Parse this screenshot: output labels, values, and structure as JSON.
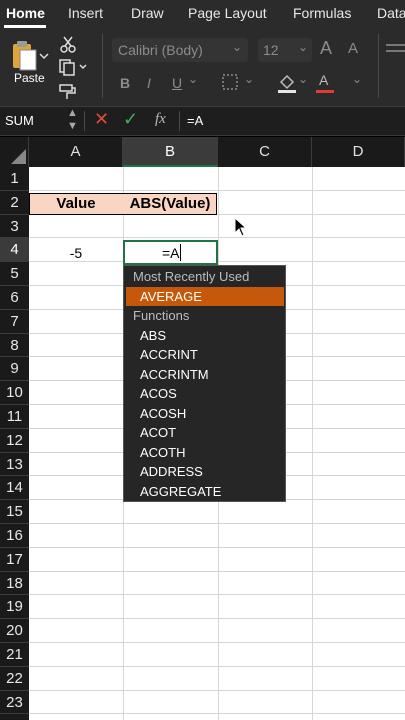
{
  "ribbon_tabs": [
    "Home",
    "Insert",
    "Draw",
    "Page Layout",
    "Formulas",
    "Data"
  ],
  "clipboard": {
    "paste_label": "Paste"
  },
  "font": {
    "name": "Calibri (Body)",
    "size": "12",
    "increase_icon": "A",
    "decrease_icon": "A"
  },
  "format_buttons": {
    "bold": "B",
    "italic": "I",
    "underline": "U"
  },
  "formula_bar": {
    "name_box": "SUM",
    "fx_label": "fx",
    "formula": "=A"
  },
  "columns": [
    "A",
    "B",
    "C",
    "D"
  ],
  "rows": [
    "1",
    "2",
    "3",
    "4",
    "5",
    "6",
    "7",
    "8",
    "9",
    "10",
    "11",
    "12",
    "13",
    "14",
    "15",
    "16",
    "17",
    "18",
    "19",
    "20",
    "21",
    "22",
    "23"
  ],
  "cells": {
    "A2": "Value",
    "B2": "ABS(Value)",
    "A4": "-5",
    "B4": "=A"
  },
  "autocomplete": {
    "recent_header": "Most Recently Used",
    "recent": [
      "AVERAGE"
    ],
    "functions_header": "Functions",
    "functions": [
      "ABS",
      "ACCRINT",
      "ACCRINTM",
      "ACOS",
      "ACOSH",
      "ACOT",
      "ACOTH",
      "ADDRESS",
      "AGGREGATE"
    ]
  },
  "colors": {
    "header_fill": "#f9d5c4",
    "selection_green": "#217346",
    "autocomplete_highlight": "#c5580a"
  }
}
